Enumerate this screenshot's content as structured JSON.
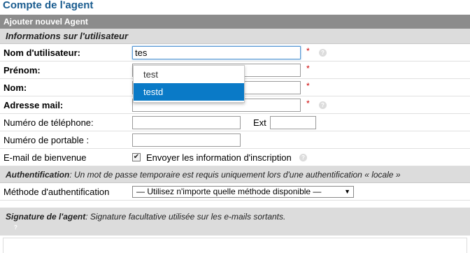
{
  "page_title": "Compte de l'agent",
  "header": "Ajouter nouvel Agent",
  "section_user": "Informations sur l'utilisateur",
  "fields": {
    "username": {
      "label": "Nom d'utilisateur:",
      "value": "tes"
    },
    "firstname": {
      "label": "Prénom:",
      "value": ""
    },
    "lastname": {
      "label": "Nom:",
      "value": ""
    },
    "email": {
      "label": "Adresse mail:",
      "value": ""
    },
    "phone": {
      "label": "Numéro de téléphone:",
      "value": "",
      "ext_label": "Ext",
      "ext_value": ""
    },
    "mobile": {
      "label": "Numéro de portable :",
      "value": ""
    },
    "welcome": {
      "label": "E-mail de bienvenue",
      "checkbox_text": "Envoyer les information d'inscription",
      "checked": true
    }
  },
  "required_mark": "*",
  "help_mark": "?",
  "checkbox_mark": "✔",
  "autocomplete": [
    "test",
    "testd"
  ],
  "auth": {
    "title": "Authentification",
    "desc": ": Un mot de passe temporaire est requis uniquement lors d'une authentification « locale »",
    "method_label": "Méthode d'authentification",
    "method_value": "— Utilisez n'importe quelle méthode disponible —",
    "caret": "▼"
  },
  "signature": {
    "title": "Signature de l'agent",
    "desc": ": Signature facultative utilisée sur les e-mails sortants."
  }
}
